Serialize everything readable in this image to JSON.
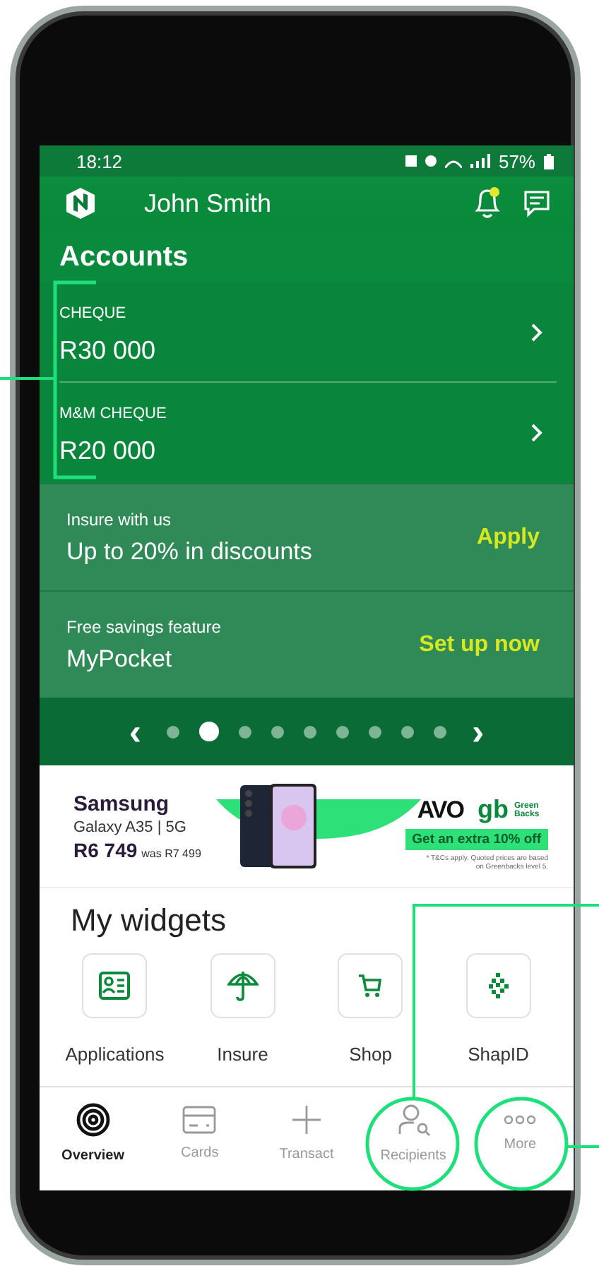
{
  "status_bar": {
    "time": "18:12",
    "battery": "57%"
  },
  "header": {
    "name": "John Smith",
    "unread": true
  },
  "accounts": {
    "title": "Accounts",
    "items": [
      {
        "type": "CHEQUE",
        "balance": "R30 000"
      },
      {
        "type": "M&M CHEQUE",
        "balance": "R20 000"
      }
    ]
  },
  "promos": [
    {
      "caption": "Insure with us",
      "title": "Up to 20% in discounts",
      "action": "Apply"
    },
    {
      "caption": "Free savings feature",
      "title": "MyPocket",
      "action": "Set up now"
    }
  ],
  "carousel": {
    "prev": "‹",
    "next": "›",
    "dots": [
      {
        "selected": false
      },
      {
        "selected": true
      },
      {
        "selected": false
      },
      {
        "selected": false
      },
      {
        "selected": false
      },
      {
        "selected": false
      },
      {
        "selected": false
      },
      {
        "selected": false
      },
      {
        "selected": false
      }
    ]
  },
  "ad": {
    "brand": "Samsung",
    "model": "Galaxy A35 | 5G",
    "price": "R6 749",
    "was": "was R7 499",
    "logo_1": "AVO",
    "logo_2": "gb",
    "logo_2_caption": "Green Backs",
    "offer": "Get an extra 10% off",
    "disclaimer": "* T&Cs apply. Quoted prices are based on Greenbacks level 5."
  },
  "widgets": {
    "title": "My widgets",
    "items": [
      {
        "label": "Applications",
        "kind": "applications"
      },
      {
        "label": "Insure",
        "kind": "insure"
      },
      {
        "label": "Shop",
        "kind": "shop"
      },
      {
        "label": "ShapID",
        "kind": "shapid"
      }
    ]
  },
  "nav": [
    {
      "label": "Overview",
      "kind": "overview",
      "selected": true
    },
    {
      "label": "Cards",
      "kind": "cards",
      "selected": false
    },
    {
      "label": "Transact",
      "kind": "transact",
      "selected": false
    },
    {
      "label": "Recipients",
      "kind": "recipients",
      "selected": false
    },
    {
      "label": "More",
      "kind": "more",
      "selected": false
    }
  ]
}
